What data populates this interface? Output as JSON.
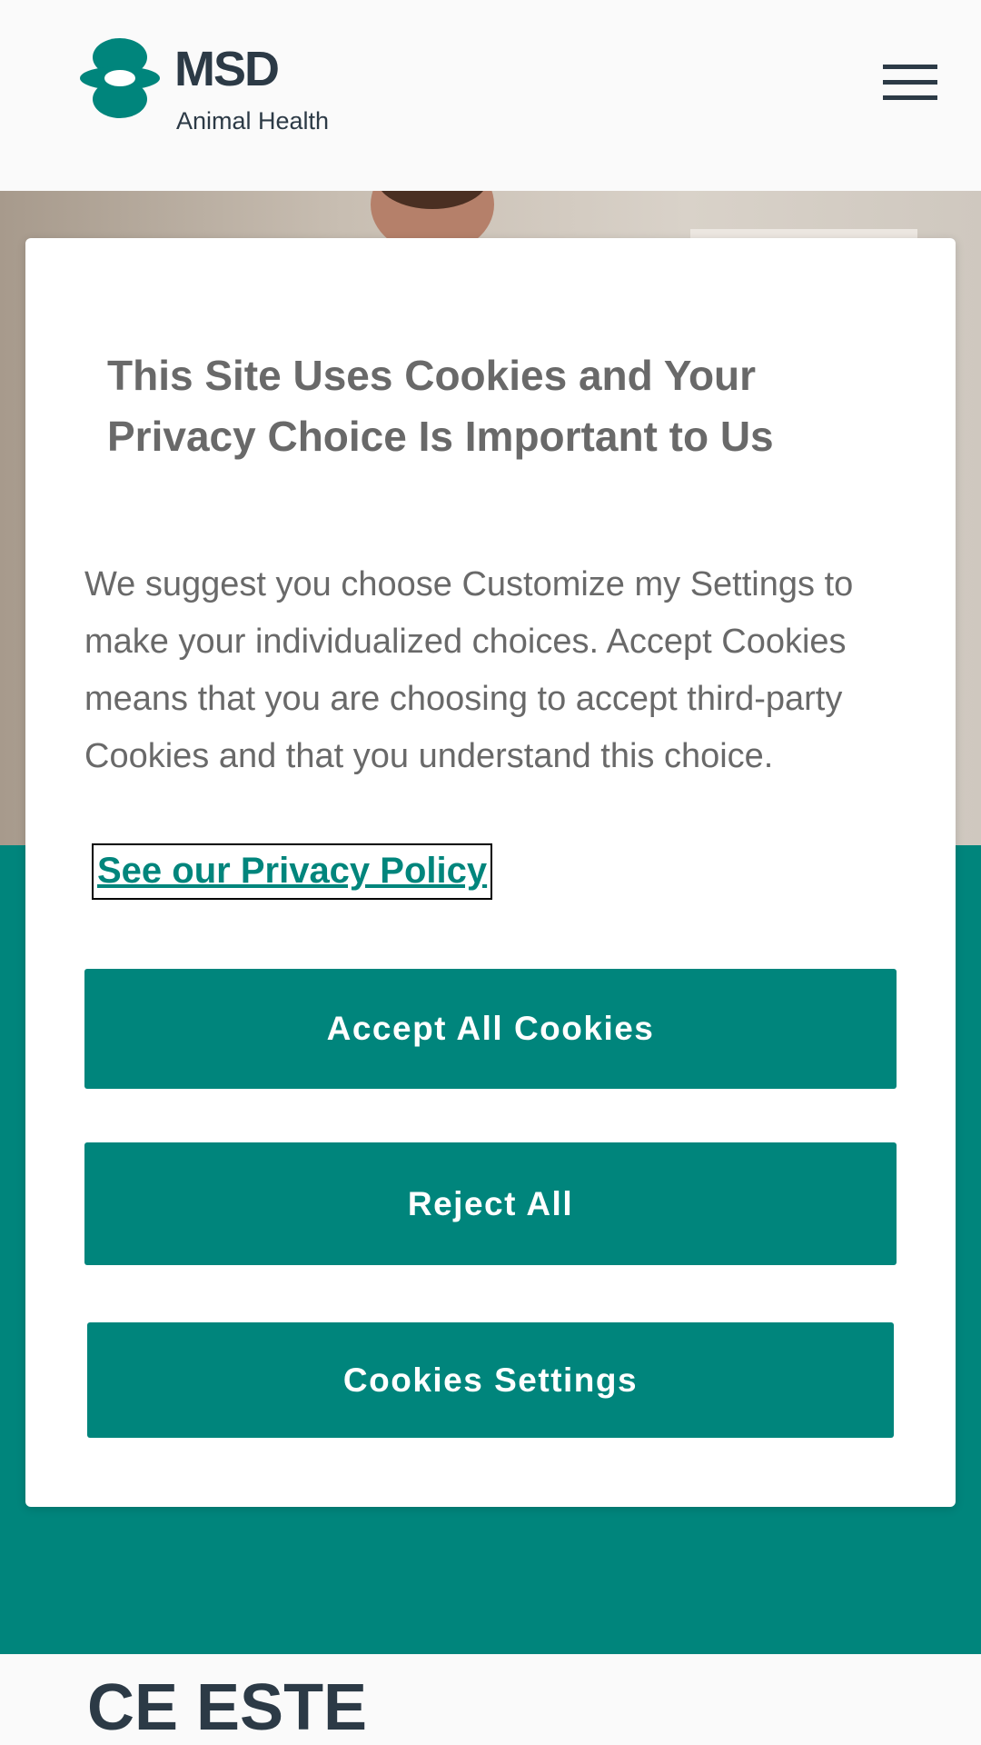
{
  "header": {
    "logo": {
      "brand": "MSD",
      "subtitle": "Animal Health",
      "mark_color": "#00857c"
    },
    "menu_icon": "hamburger-menu-icon"
  },
  "page": {
    "section_title": "CE ESTE"
  },
  "cookie_banner": {
    "title": "This Site Uses Cookies and Your Privacy Choice Is Important to Us",
    "body": "We suggest you choose Customize my Settings to make your individualized choices. Accept Cookies means that you are choosing to accept third-party Cookies and that you understand this choice.",
    "privacy_link": "See our Privacy Policy",
    "accept_label": "Accept All Cookies",
    "reject_label": "Reject All",
    "settings_label": "Cookies Settings"
  },
  "colors": {
    "brand_teal": "#00857c",
    "text_gray": "#696969",
    "navy": "#2c3a46"
  }
}
